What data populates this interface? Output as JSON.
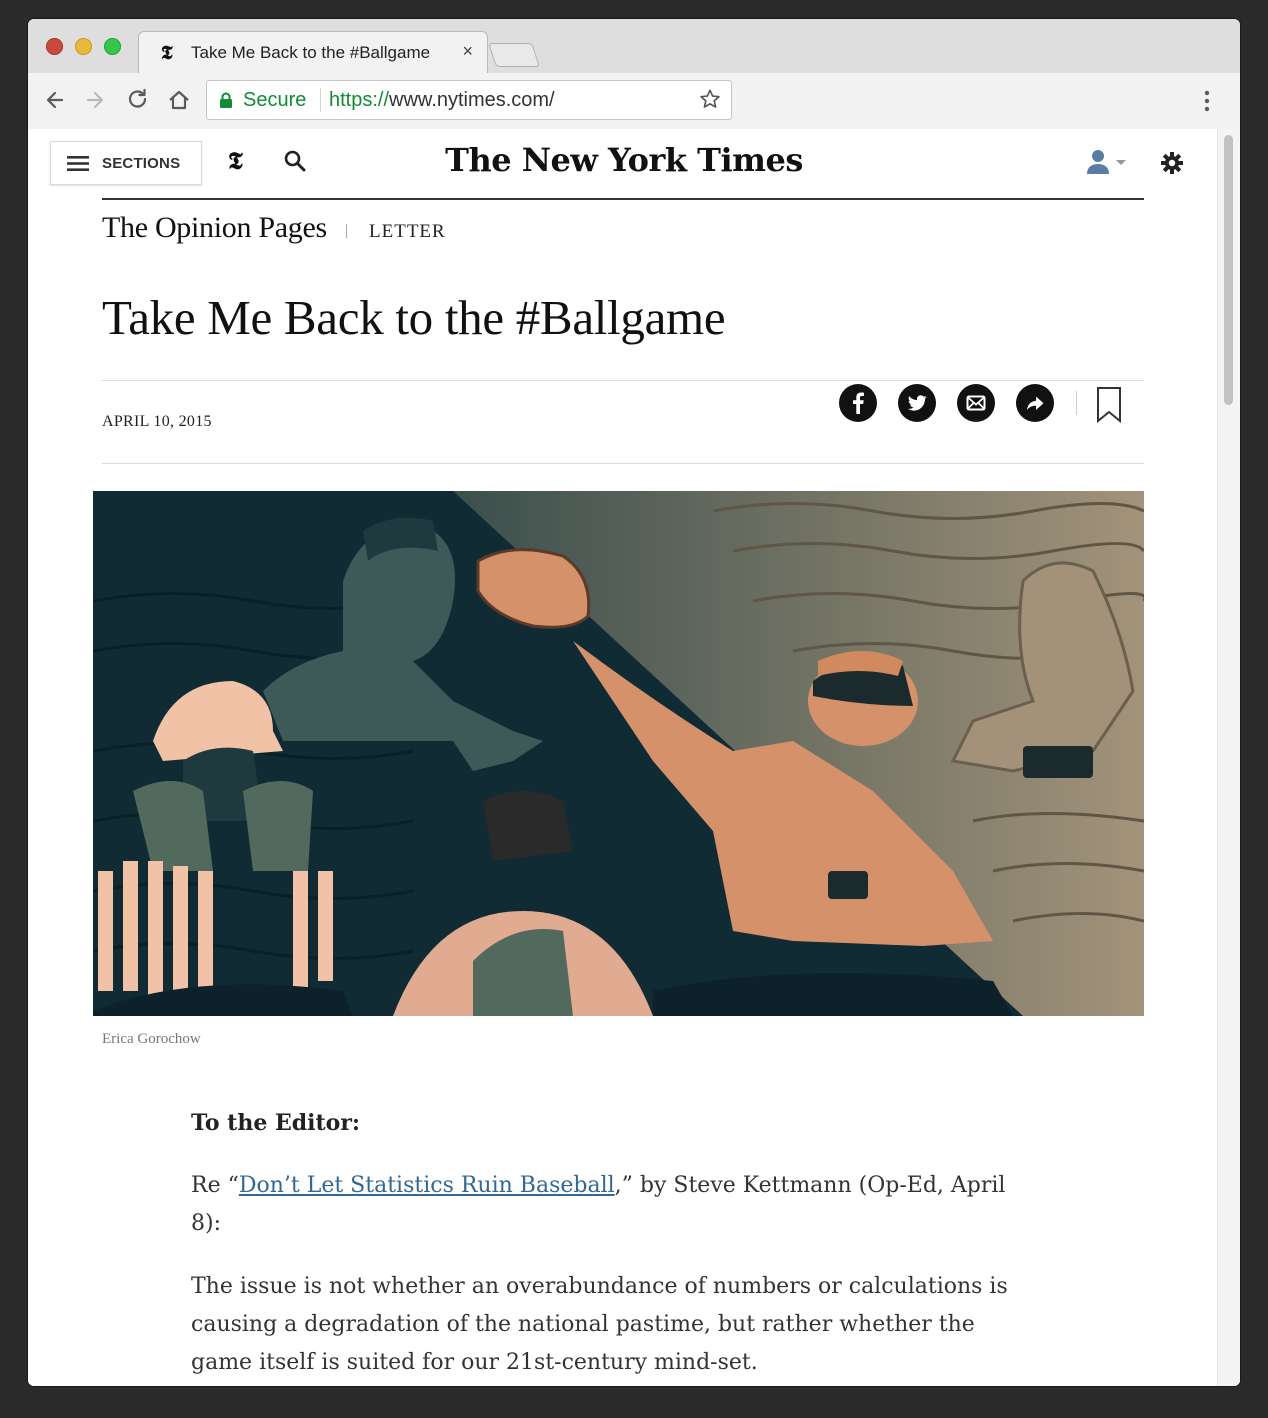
{
  "browser": {
    "tab_title": "Take Me Back to the #Ballgame",
    "tab_favicon": "𝕿",
    "tab_close": "×",
    "secure_label": "Secure",
    "url_scheme": "https://",
    "url_rest": "www.nytimes.com/",
    "icons": [
      "back-arrow-icon",
      "forward-arrow-icon",
      "reload-icon",
      "home-icon",
      "lock-icon",
      "star-icon",
      "menu-dots-icon"
    ]
  },
  "masthead": {
    "sections_label": "SECTIONS",
    "t_logo": "𝕿",
    "title": "The New York Times",
    "icons": [
      "hamburger-icon",
      "search-icon",
      "user-icon",
      "gear-icon"
    ]
  },
  "article": {
    "section": "The Opinion Pages",
    "kicker": "LETTER",
    "headline": "Take Me Back to the #Ballgame",
    "date": "APRIL 10, 2015",
    "share_icons": [
      "facebook-icon",
      "twitter-icon",
      "email-icon",
      "share-icon",
      "bookmark-icon"
    ],
    "image_credit": "Erica Gorochow",
    "salutation": "To the Editor:",
    "re_prefix": "Re “",
    "re_link": "Don’t Let Statistics Ruin Baseball",
    "re_suffix": ",” by Steve Kettmann (Op-Ed, April 8):",
    "paragraph_1": "The issue is not whether an overabundance of numbers or calculations is causing a degradation of the national pastime, but rather whether the game itself is suited for our 21st-century mind-set."
  },
  "colors": {
    "link": "#326891",
    "secure_green": "#138a36",
    "illustration_dark": "#0f2a33",
    "illustration_teal": "#3d5a58",
    "illustration_tan": "#a39279",
    "illustration_orange": "#d5916a"
  }
}
